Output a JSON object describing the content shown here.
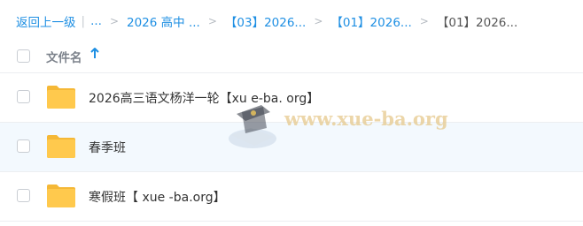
{
  "breadcrumb": {
    "back": "返回上一级",
    "ellipsis": "...",
    "items": [
      "2026 高中 ...",
      "【03】2026...",
      "【01】2026...",
      "【01】2026..."
    ]
  },
  "header": {
    "name_label": "文件名"
  },
  "files": [
    {
      "name": "2026高三语文杨洋一轮【xu e-ba. org】",
      "type": "folder-icon"
    },
    {
      "name": "春季班",
      "type": "folder-icon"
    },
    {
      "name": "寒假班【 xue -ba.org】",
      "type": "folder-icon"
    }
  ],
  "watermark": {
    "text": "www.xue-ba.org"
  },
  "colors": {
    "accent": "#1e8fe3",
    "folder": "#ffc64a",
    "row_hover": "#f3f9fe"
  }
}
